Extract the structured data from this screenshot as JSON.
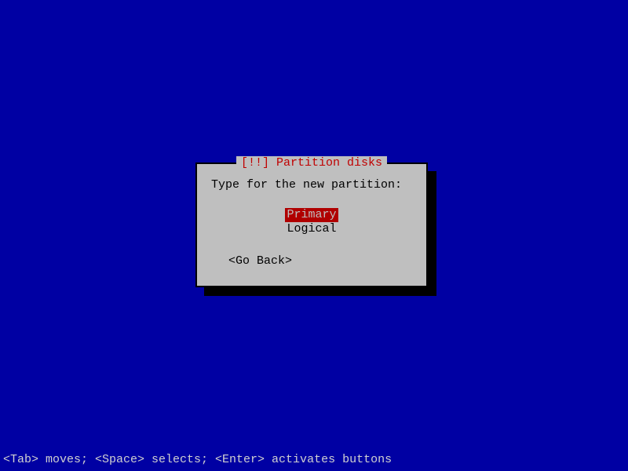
{
  "dialog": {
    "title": "[!!] Partition disks",
    "prompt": "Type for the new partition:",
    "options": {
      "primary": "Primary",
      "logical": "Logical"
    },
    "goBack": "<Go Back>"
  },
  "statusbar": "<Tab> moves; <Space> selects; <Enter> activates buttons"
}
